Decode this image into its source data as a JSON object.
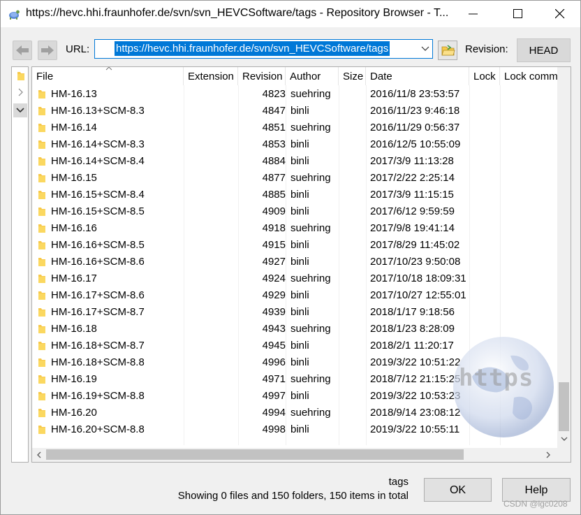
{
  "window": {
    "title": "https://hevc.hhi.fraunhofer.de/svn/svn_HEVCSoftware/tags - Repository Browser - T..."
  },
  "toolbar": {
    "url_label": "URL:",
    "url_value": "https://hevc.hhi.fraunhofer.de/svn/svn_HEVCSoftware/tags",
    "revision_label": "Revision:",
    "revision_value": "HEAD"
  },
  "columns": {
    "file": "File",
    "extension": "Extension",
    "revision": "Revision",
    "author": "Author",
    "size": "Size",
    "date": "Date",
    "lock": "Lock",
    "lock_comment": "Lock comm"
  },
  "rows": [
    {
      "name": "HM-16.13",
      "revision": "4823",
      "author": "suehring",
      "date": "2016/11/8 23:53:57"
    },
    {
      "name": "HM-16.13+SCM-8.3",
      "revision": "4847",
      "author": "binli",
      "date": "2016/11/23 9:46:18"
    },
    {
      "name": "HM-16.14",
      "revision": "4851",
      "author": "suehring",
      "date": "2016/11/29 0:56:37"
    },
    {
      "name": "HM-16.14+SCM-8.3",
      "revision": "4853",
      "author": "binli",
      "date": "2016/12/5 10:55:09"
    },
    {
      "name": "HM-16.14+SCM-8.4",
      "revision": "4884",
      "author": "binli",
      "date": "2017/3/9 11:13:28"
    },
    {
      "name": "HM-16.15",
      "revision": "4877",
      "author": "suehring",
      "date": "2017/2/22 2:25:14"
    },
    {
      "name": "HM-16.15+SCM-8.4",
      "revision": "4885",
      "author": "binli",
      "date": "2017/3/9 11:15:15"
    },
    {
      "name": "HM-16.15+SCM-8.5",
      "revision": "4909",
      "author": "binli",
      "date": "2017/6/12 9:59:59"
    },
    {
      "name": "HM-16.16",
      "revision": "4918",
      "author": "suehring",
      "date": "2017/9/8 19:41:14"
    },
    {
      "name": "HM-16.16+SCM-8.5",
      "revision": "4915",
      "author": "binli",
      "date": "2017/8/29 11:45:02"
    },
    {
      "name": "HM-16.16+SCM-8.6",
      "revision": "4927",
      "author": "binli",
      "date": "2017/10/23 9:50:08"
    },
    {
      "name": "HM-16.17",
      "revision": "4924",
      "author": "suehring",
      "date": "2017/10/18 18:09:31"
    },
    {
      "name": "HM-16.17+SCM-8.6",
      "revision": "4929",
      "author": "binli",
      "date": "2017/10/27 12:55:01"
    },
    {
      "name": "HM-16.17+SCM-8.7",
      "revision": "4939",
      "author": "binli",
      "date": "2018/1/17 9:18:56"
    },
    {
      "name": "HM-16.18",
      "revision": "4943",
      "author": "suehring",
      "date": "2018/1/23 8:28:09"
    },
    {
      "name": "HM-16.18+SCM-8.7",
      "revision": "4945",
      "author": "binli",
      "date": "2018/2/1 11:20:17"
    },
    {
      "name": "HM-16.18+SCM-8.8",
      "revision": "4996",
      "author": "binli",
      "date": "2019/3/22 10:51:22"
    },
    {
      "name": "HM-16.19",
      "revision": "4971",
      "author": "suehring",
      "date": "2018/7/12 21:15:25"
    },
    {
      "name": "HM-16.19+SCM-8.8",
      "revision": "4997",
      "author": "binli",
      "date": "2019/3/22 10:53:23"
    },
    {
      "name": "HM-16.20",
      "revision": "4994",
      "author": "suehring",
      "date": "2018/9/14 23:08:12"
    },
    {
      "name": "HM-16.20+SCM-8.8",
      "revision": "4998",
      "author": "binli",
      "date": "2019/3/22 10:55:11"
    }
  ],
  "footer": {
    "current_path": "tags",
    "status": "Showing 0 files and 150 folders, 150 items in total",
    "ok_label": "OK",
    "help_label": "Help"
  },
  "watermark": {
    "globe_text": "https",
    "source_mark": "CSDN @lgc0208"
  },
  "colors": {
    "accent": "#0078d7",
    "folder": "#f7c94b"
  },
  "icons": [
    "tortoise-svn-icon",
    "minimize-icon",
    "maximize-icon",
    "close-icon",
    "back-arrow-icon",
    "forward-arrow-icon",
    "dropdown-caret-icon",
    "browse-folder-icon",
    "folder-icon",
    "sort-ascending-icon",
    "chevron-right-icon",
    "chevron-down-icon"
  ]
}
